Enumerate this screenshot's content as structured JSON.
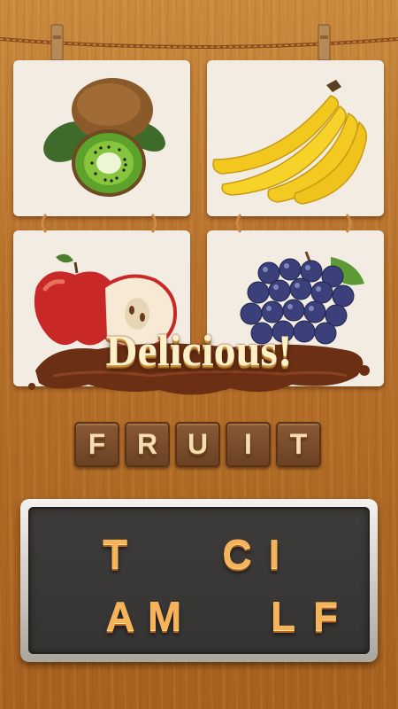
{
  "banner": {
    "text": "Delicious!"
  },
  "answer": {
    "letters": [
      "F",
      "R",
      "U",
      "I",
      "T"
    ]
  },
  "pictures": [
    {
      "subject": "kiwi"
    },
    {
      "subject": "banana"
    },
    {
      "subject": "apple"
    },
    {
      "subject": "grapes"
    }
  ],
  "keyboard": {
    "row1": [
      "T",
      "",
      "",
      "C",
      "I",
      ""
    ],
    "row2": [
      "A",
      "M",
      "",
      "",
      "L",
      "F"
    ]
  },
  "colors": {
    "wood": "#b7712b",
    "board": "#3d3c3a",
    "key_letter": "#f6b45a",
    "tile": "#6b4023",
    "banner_text": "#fdf0c8"
  }
}
